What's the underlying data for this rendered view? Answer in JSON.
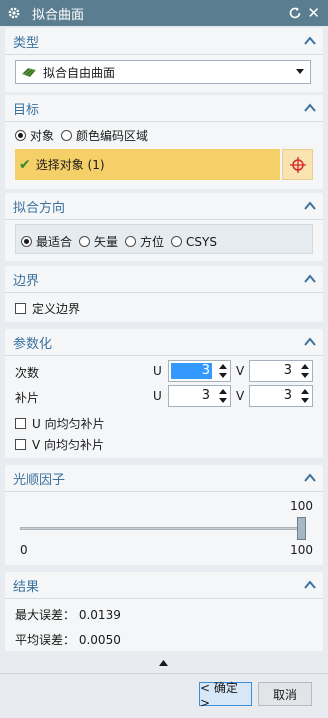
{
  "window": {
    "title": "拟合曲面"
  },
  "type_section": {
    "title": "类型",
    "selected": "拟合自由曲面"
  },
  "target_section": {
    "title": "目标",
    "radio_object": "对象",
    "radio_color_region": "颜色编码区域",
    "select_object_label": "选择对象 (1)"
  },
  "direction_section": {
    "title": "拟合方向",
    "options": [
      "最适合",
      "矢量",
      "方位",
      "CSYS"
    ]
  },
  "boundary_section": {
    "title": "边界",
    "define_boundary": "定义边界"
  },
  "params_section": {
    "title": "参数化",
    "degree_label": "次数",
    "patch_label": "补片",
    "u_label": "U",
    "v_label": "V",
    "degree_u": "3",
    "degree_v": "3",
    "patch_u": "3",
    "patch_v": "3",
    "u_uniform": "U 向均匀补片",
    "v_uniform": "V 向均匀补片"
  },
  "smooth_section": {
    "title": "光顺因子",
    "value_label": "100",
    "min": "0",
    "max": "100",
    "level_fraction": 1.0
  },
  "result_section": {
    "title": "结果",
    "max_error_label": "最大误差：",
    "max_error_value": "0.0139",
    "avg_error_label": "平均误差：",
    "avg_error_value": "0.0050"
  },
  "footer": {
    "ok_label": "< 确定 >",
    "cancel_label": "取消"
  },
  "colors": {
    "accent": "#3b72a0",
    "title_bar": "#5b7d90",
    "highlight": "#f5cf67",
    "selection": "#3399ff"
  }
}
